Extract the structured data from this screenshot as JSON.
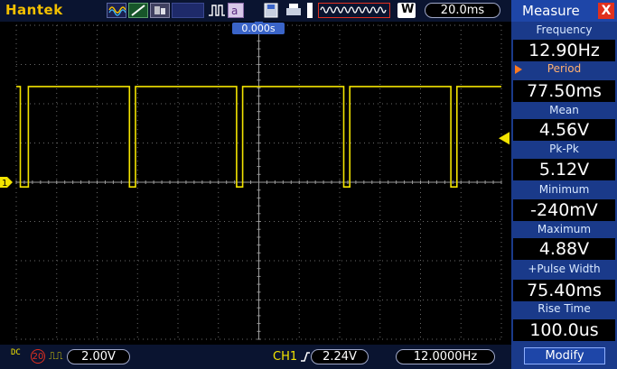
{
  "toolbar": {
    "brand": "Hantek",
    "buffer_mode": "W",
    "timebase": "20.0ms"
  },
  "screen": {
    "trigger_time": "0.000s",
    "channel_marker": "1"
  },
  "bottom": {
    "coupling": "DC",
    "bandwidth_limit": "20",
    "volts_per_div": "2.00V",
    "trigger_source": "CH1",
    "trigger_level": "2.24V",
    "trigger_frequency": "12.0000Hz"
  },
  "measure": {
    "title": "Measure",
    "close": "X",
    "items": [
      {
        "label": "Frequency",
        "value": "12.90Hz"
      },
      {
        "label": "Period",
        "value": "77.50ms"
      },
      {
        "label": "Mean",
        "value": "4.56V"
      },
      {
        "label": "Pk-Pk",
        "value": "5.12V"
      },
      {
        "label": "Minimum",
        "value": "-240mV"
      },
      {
        "label": "Maximum",
        "value": "4.88V"
      },
      {
        "label": "+Pulse Width",
        "value": "75.40ms"
      },
      {
        "label": "Rise Time",
        "value": "100.0us"
      }
    ],
    "modify": "Modify"
  },
  "colors": {
    "trace": "#f3e400",
    "grid": "#6a6a6a",
    "panel": "#1a3a8a",
    "accent": "#3a64c8"
  },
  "icons": [
    "waveform-icon",
    "line-icon",
    "mode-icon",
    "pulse-icon",
    "a-icon",
    "save-icon",
    "print-icon",
    "buffer-wave-icon",
    "close-icon",
    "trigger-rise-icon",
    "invert-icon"
  ],
  "chart_data": {
    "type": "line",
    "x_unit": "divisions",
    "y_unit": "V",
    "time_per_div": "20.0ms",
    "volts_per_div": "2.00V",
    "high_level_v": 4.88,
    "low_level_v": -0.24,
    "low_pulses_div": [
      [
        0.1,
        0.3
      ],
      [
        2.8,
        2.95
      ],
      [
        5.45,
        5.6
      ],
      [
        8.1,
        8.25
      ],
      [
        10.75,
        10.9
      ]
    ]
  }
}
